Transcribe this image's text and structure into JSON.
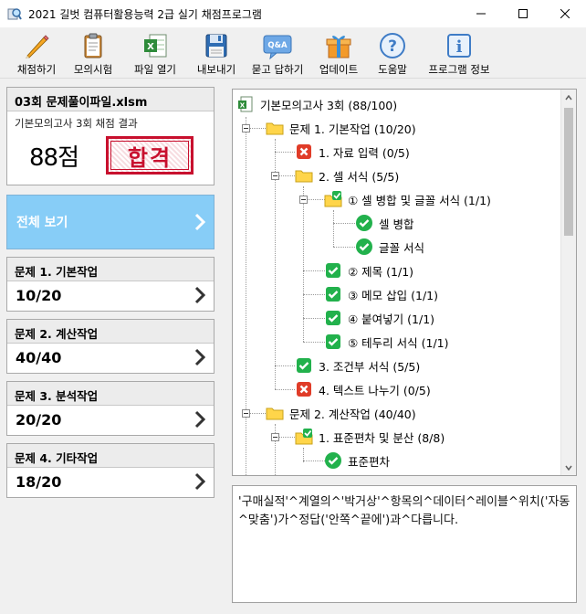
{
  "window": {
    "title": "2021 길벗 컴퓨터활용능력 2급 실기 채점프로그램",
    "controls": [
      "minimize",
      "maximize",
      "close"
    ]
  },
  "toolbar": [
    {
      "label": "채점하기",
      "icon": "pencil-icon"
    },
    {
      "label": "모의시험",
      "icon": "clipboard-icon"
    },
    {
      "label": "파일 열기",
      "icon": "excel-file-icon"
    },
    {
      "label": "내보내기",
      "icon": "save-disk-icon"
    },
    {
      "label": "묻고 답하기",
      "icon": "qa-icon"
    },
    {
      "label": "업데이트",
      "icon": "gift-icon"
    },
    {
      "label": "도움말",
      "icon": "question-icon"
    },
    {
      "label": "프로그램 정보",
      "icon": "info-icon"
    }
  ],
  "summary": {
    "file_name": "03회 문제풀이파일.xlsm",
    "subtitle": "기본모의고사 3회 채점 결과",
    "score": "88점",
    "stamp": "합격"
  },
  "view_all": {
    "label": "전체 보기"
  },
  "problems": [
    {
      "title": "문제 1. 기본작업",
      "score": "10/20"
    },
    {
      "title": "문제 2. 계산작업",
      "score": "40/40"
    },
    {
      "title": "문제 3. 분석작업",
      "score": "20/20"
    },
    {
      "title": "문제 4. 기타작업",
      "score": "18/20"
    }
  ],
  "tree": [
    {
      "label": "기본모의고사 3회 (88/100)",
      "icon": "excel-icon"
    },
    {
      "label": "문제 1. 기본작업 (10/20)",
      "icon": "folder-icon"
    },
    {
      "label": "1. 자료 입력 (0/5)",
      "icon": "red-x-icon"
    },
    {
      "label": "2. 셀 서식 (5/5)",
      "icon": "folder-icon"
    },
    {
      "label": "① 셀 병합 및 글꼴 서식 (1/1)",
      "icon": "folder-check-icon"
    },
    {
      "label": "셀 병합",
      "icon": "green-check-circle-icon"
    },
    {
      "label": "글꼴 서식",
      "icon": "green-check-circle-icon"
    },
    {
      "label": "② 제목 (1/1)",
      "icon": "green-check-square-icon"
    },
    {
      "label": "③ 메모 삽입 (1/1)",
      "icon": "green-check-square-icon"
    },
    {
      "label": "④ 붙여넣기 (1/1)",
      "icon": "green-check-square-icon"
    },
    {
      "label": "⑤ 테두리 서식 (1/1)",
      "icon": "green-check-square-icon"
    },
    {
      "label": "3. 조건부 서식 (5/5)",
      "icon": "green-check-square-icon"
    },
    {
      "label": "4. 텍스트 나누기 (0/5)",
      "icon": "red-x-icon"
    },
    {
      "label": "문제 2. 계산작업 (40/40)",
      "icon": "folder-icon"
    },
    {
      "label": "1. 표준편차 및 분산 (8/8)",
      "icon": "folder-check-icon"
    },
    {
      "label": "표준편차",
      "icon": "green-check-circle-icon"
    }
  ],
  "message": "'구매실적'^계열의^'박거상'^항목의^데이터^레이블^위치('자동^맞춤')가^정답('안쪽^끝에')과^다릅니다.",
  "colors": {
    "accent_blue": "#87cdf7",
    "stamp_red": "#c8102e",
    "check_green": "#22b14c",
    "error_red": "#e03c28",
    "folder_yellow": "#ffd54a"
  }
}
